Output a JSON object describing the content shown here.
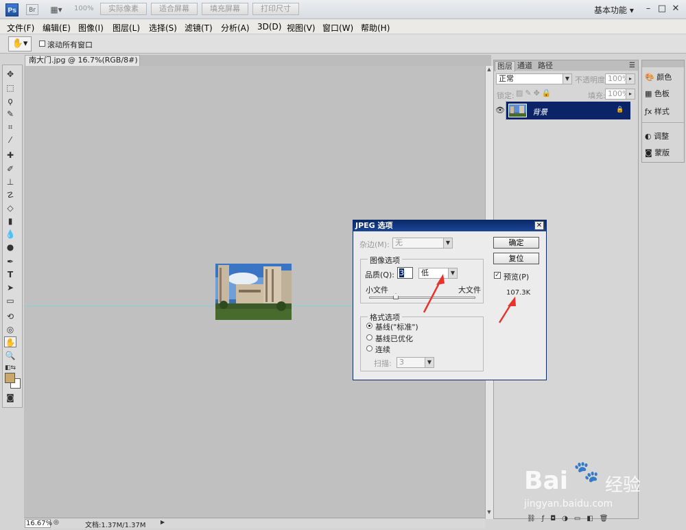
{
  "titlebar": {
    "app_badge": "Ps",
    "bridge_badge": "Br",
    "zoom": "100%",
    "workspace": "基本功能"
  },
  "menu": [
    "文件(F)",
    "编辑(E)",
    "图像(I)",
    "图层(L)",
    "选择(S)",
    "滤镜(T)",
    "分析(A)",
    "3D(D)",
    "视图(V)",
    "窗口(W)",
    "帮助(H)"
  ],
  "options": {
    "scroll_all_label": "滚动所有窗口",
    "btn_actual": "实际像素",
    "btn_fit": "适合屏幕",
    "btn_fill": "填充屏幕",
    "btn_print": "打印尺寸"
  },
  "document": {
    "tab_title": "南大门.jpg @ 16.7%(RGB/8#) *"
  },
  "status": {
    "zoom": "16.67%",
    "doc_size": "文档:1.37M/1.37M"
  },
  "layers_panel": {
    "tabs": [
      "图层",
      "通道",
      "路径"
    ],
    "blend_mode": "正常",
    "opacity_label": "不透明度:",
    "opacity": "100%",
    "lock_label": "锁定:",
    "fill_label": "填充:",
    "fill": "100%",
    "layer_name": "背景"
  },
  "right_panel": {
    "items": [
      "颜色",
      "色板",
      "样式",
      "调整",
      "蒙版"
    ]
  },
  "dialog": {
    "title": "JPEG 选项",
    "matte_label": "杂边(M):",
    "matte_value": "无",
    "ok": "确定",
    "reset": "复位",
    "preview_label": "预览(P)",
    "file_size": "107.3K",
    "image_options_title": "图像选项",
    "quality_label": "品质(Q):",
    "quality_value": "3",
    "quality_preset": "低",
    "small_file": "小文件",
    "large_file": "大文件",
    "format_title": "格式选项",
    "format_baseline": "基线(\"标准\")",
    "format_optimized": "基线已优化",
    "format_progressive": "连续",
    "scan_label": "扫描:",
    "scan_value": "3"
  },
  "watermark": {
    "brand": "Bai",
    "brand2": "经验",
    "url": "jingyan.baidu.com"
  },
  "colors": {
    "dialog_title": "#0a2a6a",
    "layer_selected": "#0a2467",
    "annotation_arrow": "#e8322b",
    "foreground_swatch": "#c9a96b"
  }
}
